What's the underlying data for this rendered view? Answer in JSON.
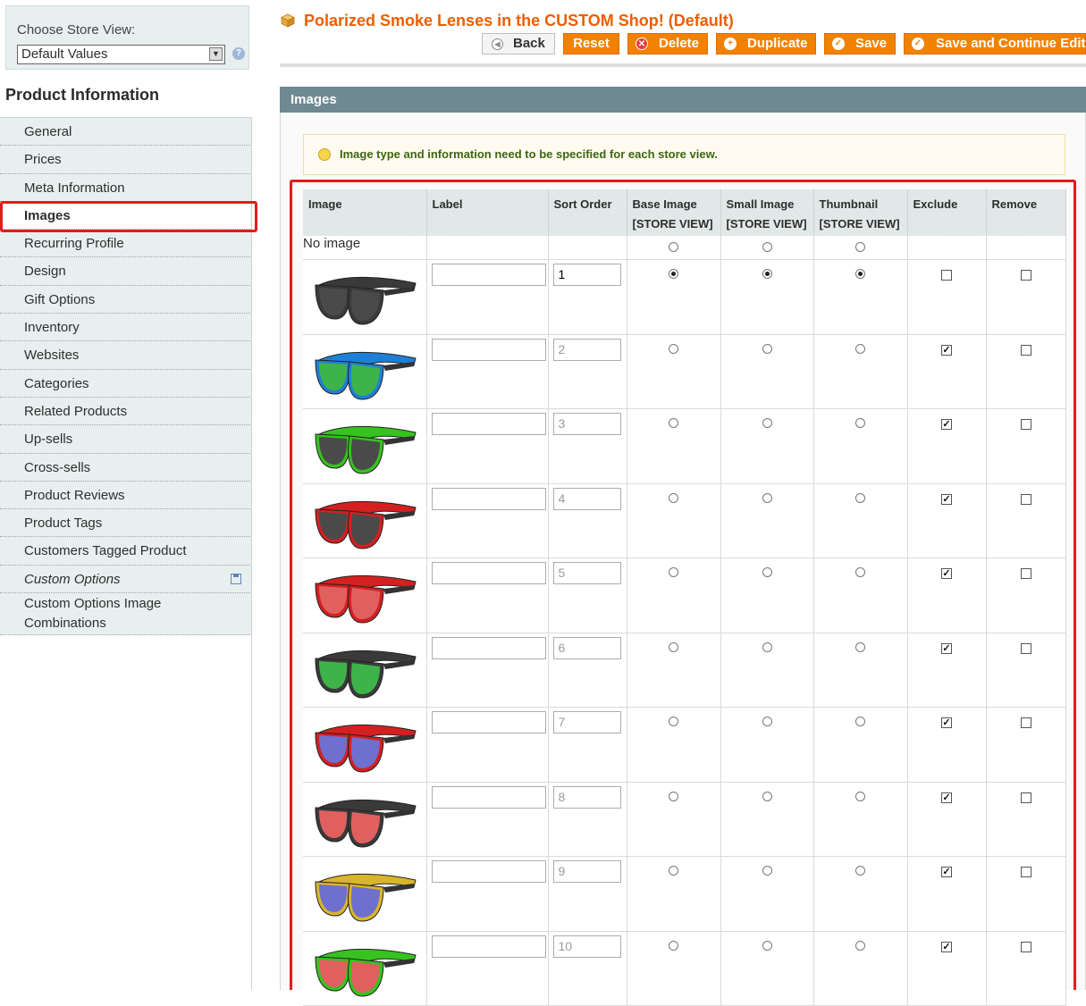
{
  "store_switcher": {
    "label": "Choose Store View:",
    "selected": "Default Values"
  },
  "sidebar": {
    "title": "Product Information",
    "tabs": [
      {
        "label": "General"
      },
      {
        "label": "Prices"
      },
      {
        "label": "Meta Information"
      },
      {
        "label": "Images"
      },
      {
        "label": "Recurring Profile"
      },
      {
        "label": "Design"
      },
      {
        "label": "Gift Options"
      },
      {
        "label": "Inventory"
      },
      {
        "label": "Websites"
      },
      {
        "label": "Categories"
      },
      {
        "label": "Related Products"
      },
      {
        "label": "Up-sells"
      },
      {
        "label": "Cross-sells"
      },
      {
        "label": "Product Reviews"
      },
      {
        "label": "Product Tags"
      },
      {
        "label": "Customers Tagged Product"
      },
      {
        "label": "Custom Options"
      },
      {
        "label": "Custom Options Image Combinations"
      }
    ],
    "active_tab": "Images"
  },
  "header": {
    "title": "Polarized Smoke Lenses in the CUSTOM Shop! (Default)",
    "buttons": {
      "back": "Back",
      "reset": "Reset",
      "delete": "Delete",
      "duplicate": "Duplicate",
      "save": "Save",
      "save_continue": "Save and Continue Edit"
    }
  },
  "section": {
    "title": "Images",
    "notice": "Image type and information need to be specified for each store view."
  },
  "table": {
    "columns": {
      "image": "Image",
      "label": "Label",
      "sort_order": "Sort Order",
      "base_image": "Base Image",
      "small_image": "Small Image",
      "thumbnail": "Thumbnail",
      "exclude": "Exclude",
      "remove": "Remove",
      "scope": "[STORE VIEW]"
    },
    "no_image_label": "No image",
    "rows": [
      {
        "sort": "1",
        "frame": "#3a3a3a",
        "lens": "#4a4a4a",
        "base": true,
        "small": true,
        "thumb": true,
        "exclude": false
      },
      {
        "sort": "2",
        "frame": "#1f7fd6",
        "lens": "#3db34a",
        "base": false,
        "small": false,
        "thumb": false,
        "exclude": true
      },
      {
        "sort": "3",
        "frame": "#36c21f",
        "lens": "#4a4a4a",
        "base": false,
        "small": false,
        "thumb": false,
        "exclude": true
      },
      {
        "sort": "4",
        "frame": "#d42020",
        "lens": "#4a4a4a",
        "base": false,
        "small": false,
        "thumb": false,
        "exclude": true
      },
      {
        "sort": "5",
        "frame": "#d42020",
        "lens": "#e06060",
        "base": false,
        "small": false,
        "thumb": false,
        "exclude": true
      },
      {
        "sort": "6",
        "frame": "#3a3a3a",
        "lens": "#3db34a",
        "base": false,
        "small": false,
        "thumb": false,
        "exclude": true
      },
      {
        "sort": "7",
        "frame": "#d42020",
        "lens": "#6f6fd0",
        "base": false,
        "small": false,
        "thumb": false,
        "exclude": true
      },
      {
        "sort": "8",
        "frame": "#3a3a3a",
        "lens": "#e06060",
        "base": false,
        "small": false,
        "thumb": false,
        "exclude": true
      },
      {
        "sort": "9",
        "frame": "#d9b52a",
        "lens": "#6f6fd0",
        "base": false,
        "small": false,
        "thumb": false,
        "exclude": true
      },
      {
        "sort": "10",
        "frame": "#36c21f",
        "lens": "#e06060",
        "base": false,
        "small": false,
        "thumb": false,
        "exclude": true
      }
    ]
  },
  "colors": {
    "accent": "#eb5e00",
    "button": "#f18200",
    "section_header": "#6f8992",
    "highlight": "#e51b1b",
    "sidebar_bg": "#e7efef"
  }
}
